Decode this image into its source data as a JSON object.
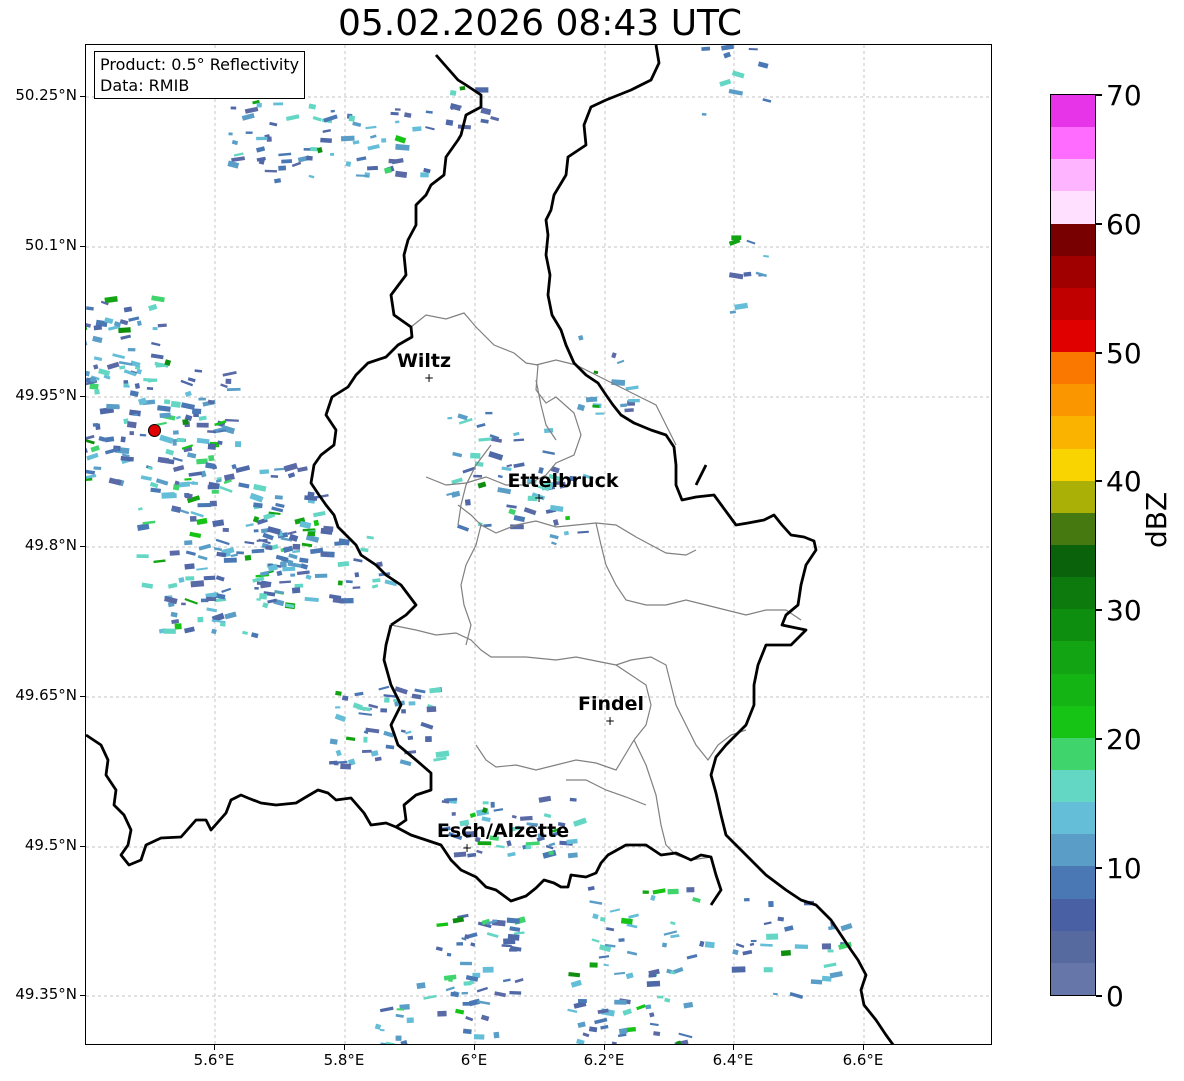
{
  "title": "05.02.2026 08:43 UTC",
  "info_box": {
    "product": "Product: 0.5° Reflectivity",
    "data_source": "Data: RMIB"
  },
  "y_ticks": [
    "50.25°N",
    "50.1°N",
    "49.95°N",
    "49.8°N",
    "49.65°N",
    "49.5°N",
    "49.35°N"
  ],
  "x_ticks": [
    "5.6°E",
    "5.8°E",
    "6°E",
    "6.2°E",
    "6.4°E",
    "6.6°E"
  ],
  "cities": [
    {
      "name": "Wiltz"
    },
    {
      "name": "Ettelbruck"
    },
    {
      "name": "Findel"
    },
    {
      "name": "Esch/Alzette"
    }
  ],
  "city_marker_glyph": "+",
  "colorbar": {
    "unit": "dBZ",
    "tick_labels": [
      "0",
      "10",
      "20",
      "30",
      "40",
      "50",
      "60",
      "70"
    ],
    "colors": [
      "#6676a8",
      "#566aa0",
      "#4a60a4",
      "#4a78b4",
      "#5a9ec8",
      "#64bed8",
      "#64d6c4",
      "#40d46c",
      "#16c416",
      "#14b414",
      "#12a412",
      "#0e8e0e",
      "#0c7a0c",
      "#0a620a",
      "#467a10",
      "#aab006",
      "#fad400",
      "#fab400",
      "#fa9600",
      "#fa7800",
      "#e00000",
      "#c00000",
      "#a00000",
      "#780000",
      "#ffe0ff",
      "#ffb4ff",
      "#ff6cff",
      "#e834e8"
    ]
  },
  "colors": {
    "border": "#000000",
    "canton_lines": "#808080",
    "grid": "#b0b0b0",
    "radar_site": "#e00000"
  }
}
